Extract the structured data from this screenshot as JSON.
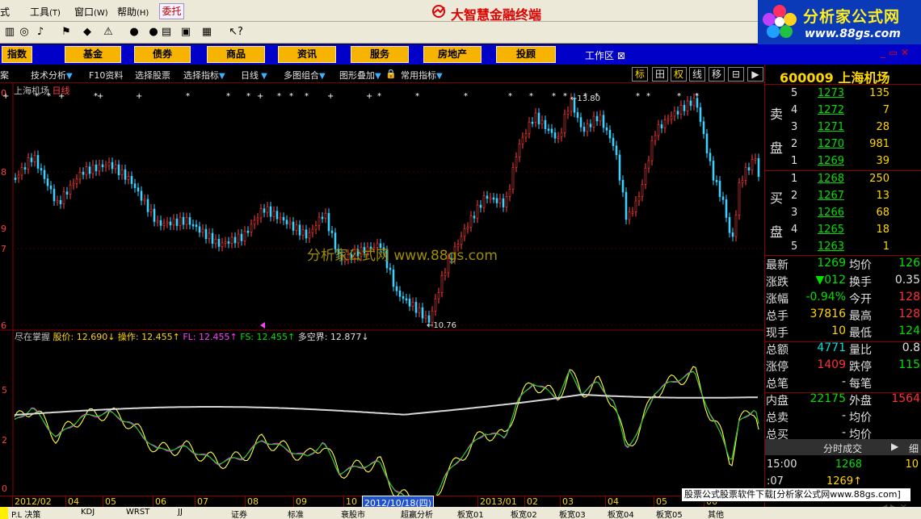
{
  "menu": {
    "items": [
      "式",
      "工具",
      "窗口",
      "帮助"
    ],
    "weituo": "委托",
    "app_title": "大智慧金融终端"
  },
  "brand": {
    "name": "分析家公式网",
    "url": "www.88gs.com"
  },
  "buttons": [
    "指数",
    "基金",
    "债券",
    "商品",
    "资讯",
    "服务",
    "房地产",
    "投顾"
  ],
  "workarea": "工作区",
  "tabs": [
    "案",
    "技术分析",
    "F10资料",
    "选择股票",
    "选择指标",
    "日线",
    "多图组合",
    "图形叠加",
    "常用指标"
  ],
  "mode_buttons": [
    "标",
    "田",
    "权",
    "线",
    "移",
    "⊟",
    "▶"
  ],
  "chart": {
    "stock_name": "上海机场",
    "period": "日线",
    "high_label": "13.80",
    "low_label": "10.76",
    "left_ticks": [
      "0",
      "8",
      "9",
      "7",
      "6"
    ],
    "indicator_ticks": [
      "5",
      "2",
      "0"
    ],
    "watermark": "分析家公式网 www.88gs.com",
    "indicator": {
      "name": "尽在掌握",
      "items": [
        {
          "label": "股价:",
          "value": "12.690",
          "arrow": "↓",
          "color": "#ffd700"
        },
        {
          "label": "操作:",
          "value": "12.455",
          "arrow": "↑",
          "color": "#ffd700"
        },
        {
          "label": "FL:",
          "value": "12.455",
          "arrow": "↑",
          "color": "#ff40ff"
        },
        {
          "label": "FS:",
          "value": "12.455",
          "arrow": "↑",
          "color": "#00e000"
        },
        {
          "label": "多空界:",
          "value": "12.877",
          "arrow": "↓",
          "color": "#e0e0e0"
        }
      ]
    }
  },
  "timeline": {
    "labels": [
      "2012/02",
      "04",
      "05",
      "06",
      "07",
      "08",
      "09",
      "10",
      "2013/01",
      "02",
      "03",
      "04",
      "05",
      "06"
    ],
    "selected": "2012/10/18(四)"
  },
  "quote": {
    "code": "600009",
    "name": "上海机场",
    "sell_label": [
      "卖",
      "盘"
    ],
    "buy_label": [
      "买",
      "盘"
    ],
    "asks": [
      {
        "lvl": "5",
        "px": "1273",
        "vol": "135"
      },
      {
        "lvl": "4",
        "px": "1272",
        "vol": "7"
      },
      {
        "lvl": "3",
        "px": "1271",
        "vol": "28"
      },
      {
        "lvl": "2",
        "px": "1270",
        "vol": "981"
      },
      {
        "lvl": "1",
        "px": "1269",
        "vol": "39"
      }
    ],
    "bids": [
      {
        "lvl": "1",
        "px": "1268",
        "vol": "250"
      },
      {
        "lvl": "2",
        "px": "1267",
        "vol": "13"
      },
      {
        "lvl": "3",
        "px": "1266",
        "vol": "68"
      },
      {
        "lvl": "4",
        "px": "1265",
        "vol": "18"
      },
      {
        "lvl": "5",
        "px": "1263",
        "vol": "1"
      }
    ],
    "stats": [
      {
        "l1": "最新",
        "v1": "1269",
        "c1": "#00e000",
        "l2": "均价",
        "v2": "126",
        "c2": "#00e000"
      },
      {
        "l1": "涨跌",
        "v1": "▼012",
        "c1": "#00e000",
        "l2": "换手",
        "v2": "0.35",
        "c2": "#e0e0e0"
      },
      {
        "l1": "涨幅",
        "v1": "-0.94%",
        "c1": "#00e000",
        "l2": "今开",
        "v2": "128",
        "c2": "#ff3030"
      },
      {
        "l1": "总手",
        "v1": "37816",
        "c1": "#ffd700",
        "l2": "最高",
        "v2": "128",
        "c2": "#ff3030"
      },
      {
        "l1": "现手",
        "v1": "10",
        "c1": "#ffd700",
        "l2": "最低",
        "v2": "124",
        "c2": "#00e000"
      },
      {
        "l1": "总额",
        "v1": "4771",
        "c1": "#00e0e0",
        "l2": "量比",
        "v2": "0.8",
        "c2": "#e0e0e0"
      },
      {
        "l1": "涨停",
        "v1": "1409",
        "c1": "#ff3030",
        "l2": "跌停",
        "v2": "115",
        "c2": "#00e000"
      },
      {
        "l1": "总笔",
        "v1": "-",
        "c1": "#e0e0e0",
        "l2": "每笔",
        "v2": "",
        "c2": "#e0e0e0"
      },
      {
        "l1": "内盘",
        "v1": "22175",
        "c1": "#00e000",
        "l2": "外盘",
        "v2": "1564",
        "c2": "#ff3030"
      },
      {
        "l1": "总卖",
        "v1": "-",
        "c1": "#e0e0e0",
        "l2": "均价",
        "v2": "",
        "c2": "#e0e0e0"
      },
      {
        "l1": "总买",
        "v1": "-",
        "c1": "#e0e0e0",
        "l2": "均价",
        "v2": "",
        "c2": "#e0e0e0"
      }
    ],
    "tick_tab": "分时成交",
    "tick_tab_extra": "细",
    "ticks": [
      {
        "time": "15:00",
        "px": "1268",
        "vol": "10",
        "pxcolor": "#00e000"
      },
      {
        "time": ":07",
        "px": "1269↑",
        "vol": "",
        "pxcolor": "#ffd700"
      }
    ]
  },
  "ad_text": "股票公式股票软件下载[分析家公式网www.88gs.com]",
  "status": [
    "P.L 决策",
    "KDJ",
    "WRST",
    "JJ",
    "证券",
    "标准",
    "衰股市",
    "超赢分析",
    "板宽01",
    "板宽02",
    "板宽03",
    "板宽04",
    "板宽05",
    "其他"
  ],
  "colors": {
    "up": "#ff4040",
    "down": "#40d0ff",
    "panel": "#0000c8",
    "button": "#f6b400"
  }
}
